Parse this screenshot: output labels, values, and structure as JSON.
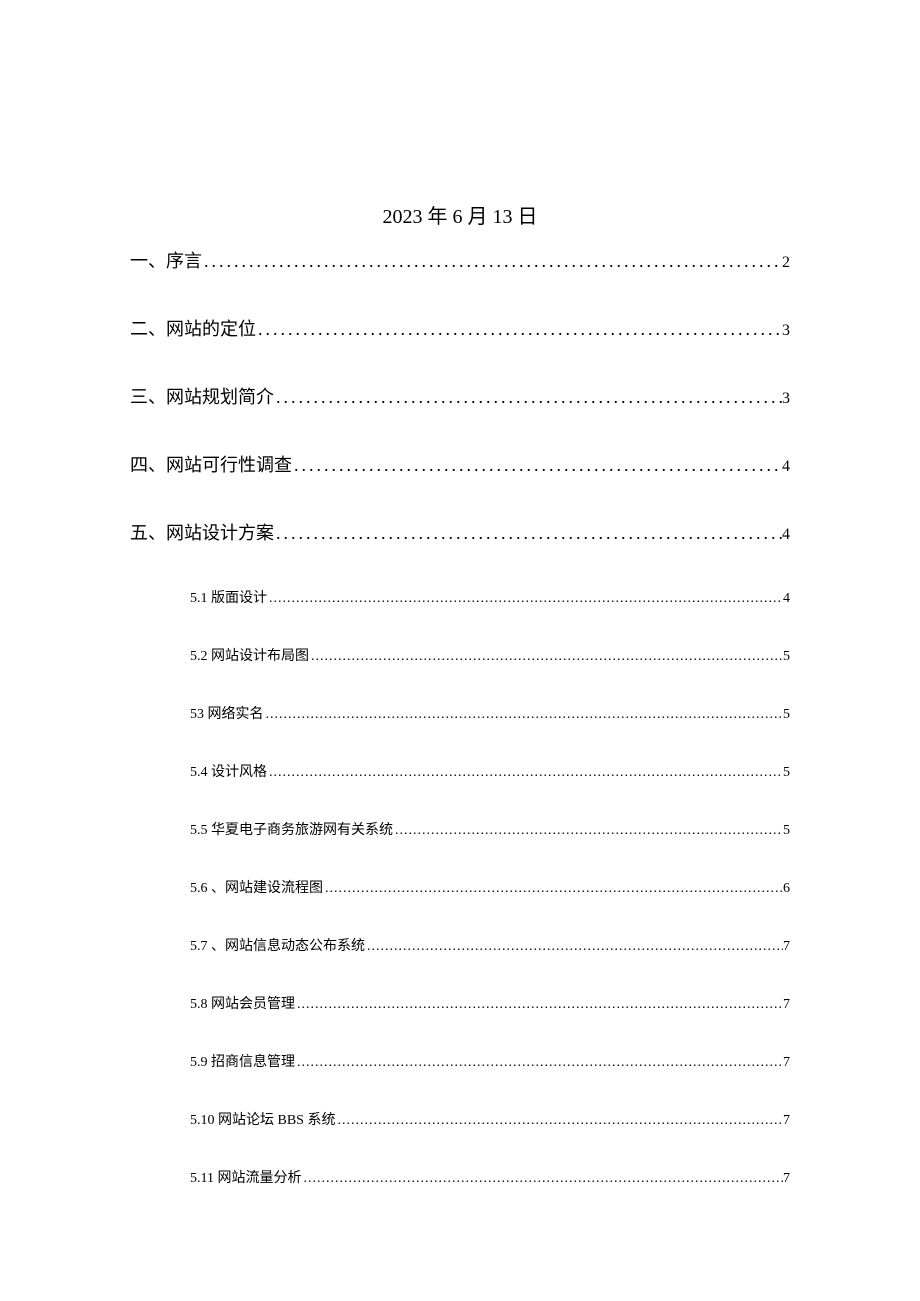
{
  "date": "2023 年 6 月 13 日",
  "toc": [
    {
      "level": 1,
      "label": "一、序言",
      "page": "2"
    },
    {
      "level": 1,
      "label": "二、网站的定位",
      "page": "3"
    },
    {
      "level": 1,
      "label": "三、网站规划简介",
      "page": "3"
    },
    {
      "level": 1,
      "label": "四、网站可行性调查",
      "page": "4"
    },
    {
      "level": 1,
      "label": "五、网站设计方案",
      "page": "4"
    },
    {
      "level": 2,
      "label": "5.1 版面设计",
      "page": "4"
    },
    {
      "level": 2,
      "label": "5.2 网站设计布局图",
      "page": "5"
    },
    {
      "level": 2,
      "label": "53 网络实名",
      "page": "5"
    },
    {
      "level": 2,
      "label": "5.4 设计风格",
      "page": "5"
    },
    {
      "level": 2,
      "label": "5.5 华夏电子商务旅游网有关系统",
      "page": "5"
    },
    {
      "level": 2,
      "label": "5.6 、网站建设流程图",
      "page": "6"
    },
    {
      "level": 2,
      "label": "5.7 、网站信息动态公布系统",
      "page": "7"
    },
    {
      "level": 2,
      "label": "5.8 网站会员管理",
      "page": "7"
    },
    {
      "level": 2,
      "label": "5.9 招商信息管理",
      "page": "7"
    },
    {
      "level": 2,
      "label": "5.10 网站论坛 BBS 系统",
      "page": "7"
    },
    {
      "level": 2,
      "label": "5.11 网站流量分析",
      "page": "7"
    }
  ]
}
